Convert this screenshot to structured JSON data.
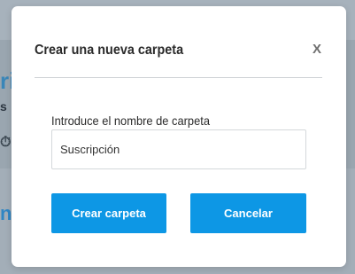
{
  "background": {
    "glyphs": [
      "ri",
      "s",
      "⏱",
      "n"
    ]
  },
  "modal": {
    "title": "Crear una nueva carpeta",
    "close_label": "X",
    "field_label": "Introduce el nombre de carpeta",
    "input_value": "Suscripción",
    "create_label": "Crear carpeta",
    "cancel_label": "Cancelar"
  },
  "colors": {
    "primary_button": "#0d97e5",
    "overlay": "#8e9aa5"
  }
}
